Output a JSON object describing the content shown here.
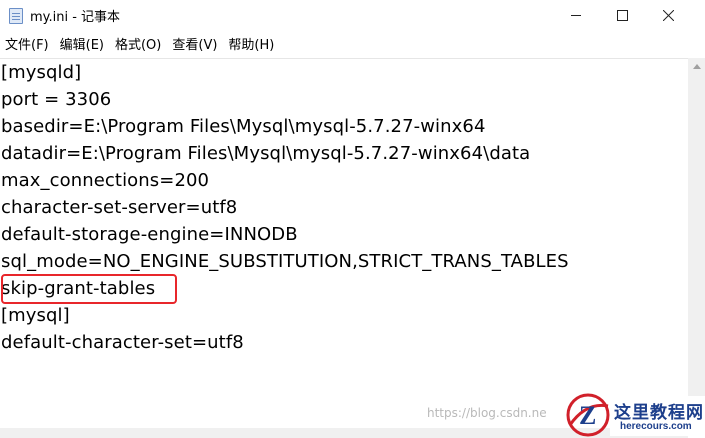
{
  "window": {
    "title": "my.ini - 记事本",
    "min_label": "—",
    "close_label": "✕"
  },
  "menu": [
    {
      "label": "文件(F)"
    },
    {
      "label": "编辑(E)"
    },
    {
      "label": "格式(O)"
    },
    {
      "label": "查看(V)"
    },
    {
      "label": "帮助(H)"
    }
  ],
  "content": {
    "lines": [
      "[mysqld]",
      "port = 3306",
      "basedir=E:\\Program Files\\Mysql\\mysql-5.7.27-winx64",
      "datadir=E:\\Program Files\\Mysql\\mysql-5.7.27-winx64\\data",
      "max_connections=200",
      "character-set-server=utf8",
      "default-storage-engine=INNODB",
      "sql_mode=NO_ENGINE_SUBSTITUTION,STRICT_TRANS_TABLES",
      "skip-grant-tables",
      "[mysql]",
      "default-character-set=utf8"
    ]
  },
  "watermark": {
    "text": "https://blog.csdn.ne"
  },
  "logo": {
    "name_cn": "这里教程网",
    "domain": "herecours.com",
    "colors": {
      "primary": "#1d3f8c",
      "accent": "#d1202a"
    }
  }
}
